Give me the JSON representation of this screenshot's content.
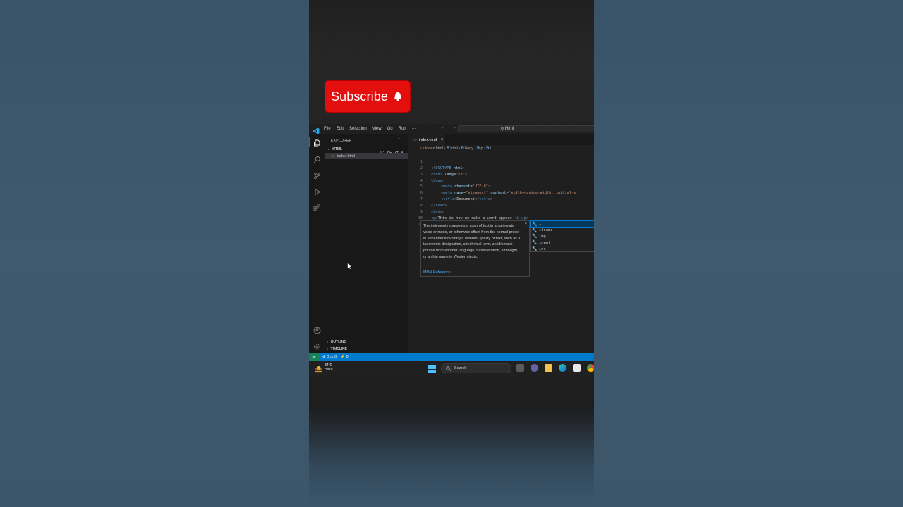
{
  "overlay": {
    "subscribe_label": "Subscribe"
  },
  "vscode": {
    "menu": [
      "File",
      "Edit",
      "Selection",
      "View",
      "Go",
      "Run",
      "···"
    ],
    "nav_arrows": "← →",
    "command_center": "Html",
    "activity_icons": [
      "explorer-icon",
      "search-icon",
      "source-control-icon",
      "run-debug-icon",
      "extensions-icon",
      "account-icon",
      "settings-gear-icon"
    ],
    "sidebar": {
      "title": "EXPLORER",
      "more": "···",
      "folder": "HTML",
      "file": "index.html",
      "outline": "OUTLINE",
      "timeline": "TIMELINE"
    },
    "editor": {
      "tab_label": "index.html",
      "tab_close": "×",
      "breadcrumb": [
        "index.html",
        "html",
        "body",
        "p",
        "i"
      ],
      "line_numbers": [
        "1",
        "2",
        "3",
        "4",
        "5",
        "6",
        "7",
        "8",
        "9",
        "10",
        "11"
      ],
      "code": {
        "l1": [
          "<!",
          "DOCTYPE",
          " html",
          ">"
        ],
        "l2": [
          "<",
          "html",
          " lang",
          "=",
          "\"en\"",
          ">"
        ],
        "l3": [
          "<",
          "head",
          ">"
        ],
        "l4": [
          "<",
          "meta",
          " charset",
          "=",
          "\"UTF-8\"",
          ">"
        ],
        "l5": [
          "<",
          "meta",
          " name",
          "=",
          "\"viewport\"",
          " content",
          "=",
          "\"width=device-width, initial-s"
        ],
        "l6": [
          "<",
          "title",
          ">",
          "Document",
          "</",
          "title",
          ">"
        ],
        "l7": [
          "</",
          "head",
          ">"
        ],
        "l8": [
          "<",
          "body",
          ">"
        ],
        "l9": [
          "<",
          "p",
          ">",
          "This is how we make a word appear ",
          "<",
          "i",
          "</",
          "p",
          ">"
        ]
      },
      "doc_popup": {
        "description": "The i element represents a span of text in an alternate voice or mood, or otherwise offset from the normal prose in a manner indicating a different quality of text, such as a taxonomic designation, a technical term, an idiomatic phrase from another language, transliteration, a thought, or a ship name in Western texts.",
        "link": "MDN Reference",
        "close": "×"
      },
      "suggestions": [
        "i",
        "iframe",
        "img",
        "input",
        "ins"
      ]
    },
    "statusbar": {
      "errors": "⊗ 0 ⚠ 0",
      "ports": "⚡ 0"
    }
  },
  "taskbar": {
    "temperature": "34°C",
    "condition": "Haze",
    "search_label": "Search"
  },
  "colors": {
    "accent": "#007acc",
    "subscribe": "#e30f0f",
    "html_tag": "#569cd6",
    "attr": "#9cdcfe",
    "string": "#ce9178"
  }
}
